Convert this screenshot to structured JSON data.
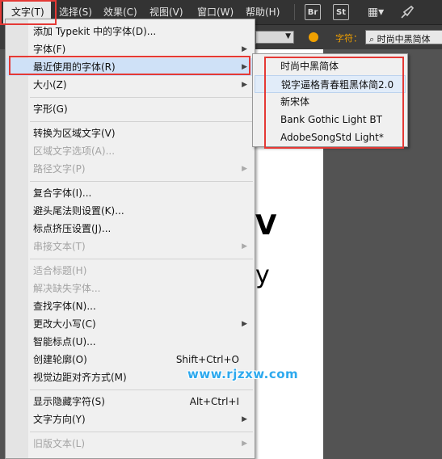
{
  "menubar": {
    "items": [
      {
        "label": "文字(T)",
        "active": true
      },
      {
        "label": "选择(S)"
      },
      {
        "label": "效果(C)"
      },
      {
        "label": "视图(V)"
      },
      {
        "label": "窗口(W)"
      },
      {
        "label": "帮助(H)"
      }
    ],
    "icons": {
      "bridge": "Br",
      "stock": "St",
      "workspace": "▦▾"
    }
  },
  "control_bar": {
    "font_label": "字符：",
    "font_value": "时尚中黑简体"
  },
  "type_menu": {
    "items": [
      {
        "label": "添加 Typekit 中的字体(D)..."
      },
      {
        "label": "字体(F)",
        "submenu": true
      },
      {
        "label": "最近使用的字体(R)",
        "submenu": true,
        "highlighted": true
      },
      {
        "label": "大小(Z)",
        "submenu": true
      },
      {
        "label": "字形(G)"
      },
      {
        "label": "转换为区域文字(V)"
      },
      {
        "label": "区域文字选项(A)...",
        "disabled": true
      },
      {
        "label": "路径文字(P)",
        "submenu": true,
        "disabled": true
      },
      {
        "label": "复合字体(I)..."
      },
      {
        "label": "避头尾法则设置(K)..."
      },
      {
        "label": "标点挤压设置(J)..."
      },
      {
        "label": "串接文本(T)",
        "submenu": true,
        "disabled": true
      },
      {
        "label": "适合标题(H)",
        "disabled": true
      },
      {
        "label": "解决缺失字体...",
        "disabled": true
      },
      {
        "label": "查找字体(N)..."
      },
      {
        "label": "更改大小写(C)",
        "submenu": true
      },
      {
        "label": "智能标点(U)..."
      },
      {
        "label": "创建轮廓(O)",
        "shortcut": "Shift+Ctrl+O"
      },
      {
        "label": "视觉边距对齐方式(M)"
      },
      {
        "label": "显示隐藏字符(S)",
        "shortcut": "Alt+Ctrl+I"
      },
      {
        "label": "文字方向(Y)",
        "submenu": true
      },
      {
        "label": "旧版文本(L)",
        "submenu": true,
        "disabled": true
      }
    ]
  },
  "recent_fonts_submenu": {
    "items": [
      {
        "label": "时尚中黑简体"
      },
      {
        "label": "锐字逼格青春粗黑体简2.0",
        "highlighted": true
      },
      {
        "label": "新宋体"
      },
      {
        "label": "Bank Gothic Light BT"
      },
      {
        "label": "AdobeSongStd Light*"
      }
    ]
  },
  "watermark": "www.rjzxw.com",
  "colors": {
    "menubar_bg": "#333333",
    "menu_bg": "#f0f0f0",
    "highlight": "#cfe1f7",
    "annotation_red": "#e53935",
    "watermark_blue": "#2da9ee",
    "font_label_orange": "#f0a000"
  }
}
